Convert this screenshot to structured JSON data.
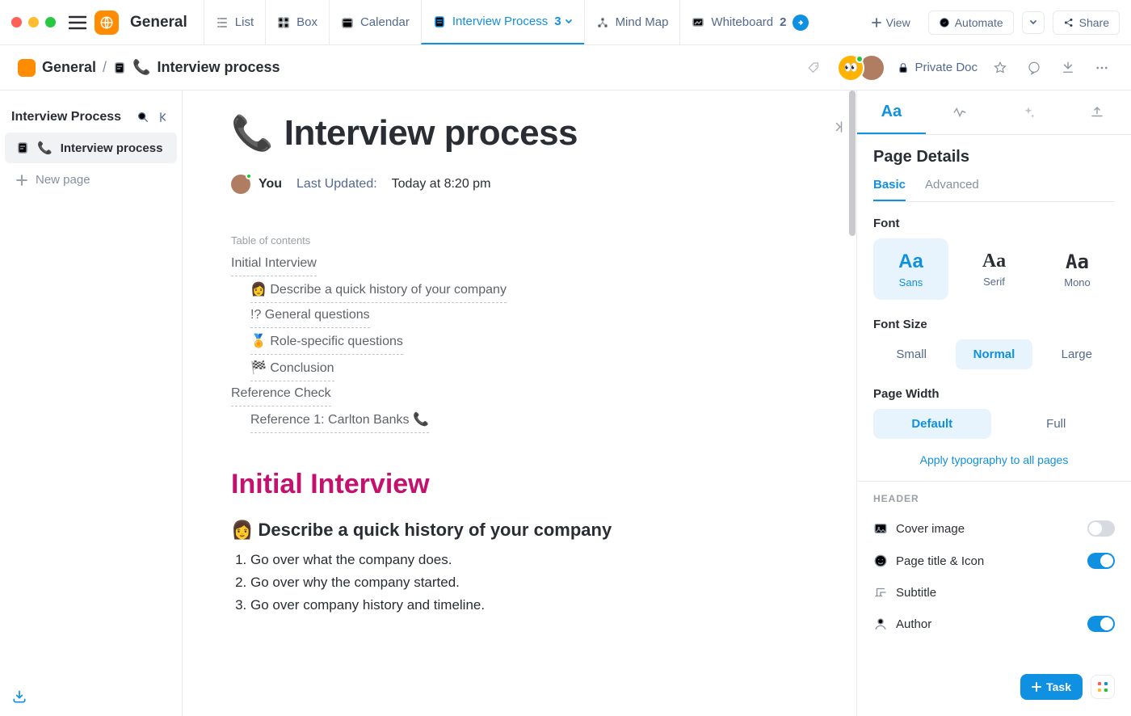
{
  "workspace": {
    "name": "General"
  },
  "top_tabs": {
    "list": "List",
    "box": "Box",
    "calendar": "Calendar",
    "interview": {
      "label": "Interview Process",
      "count": "3"
    },
    "mindmap": "Mind Map",
    "whiteboard": {
      "label": "Whiteboard",
      "count": "2"
    },
    "view": "View",
    "automate": "Automate",
    "share": "Share"
  },
  "breadcrumb": {
    "root": "General",
    "page": "Interview process",
    "private": "Private Doc"
  },
  "left": {
    "title": "Interview Process",
    "item": "Interview process",
    "new_page": "New page"
  },
  "doc": {
    "title": "Interview process",
    "you": "You",
    "updated_label": "Last Updated:",
    "updated_value": "Today at 8:20 pm",
    "toc_label": "Table of contents",
    "toc": {
      "a": "Initial Interview",
      "b": "👩 Describe a quick history of your company",
      "c": "!? General questions",
      "d": "🏅 Role-specific questions",
      "e": "🏁 Conclusion",
      "f": "Reference Check",
      "g": "Reference 1: Carlton Banks 📞"
    },
    "h1": "Initial Interview",
    "h2": "👩 Describe a quick history of your company",
    "ol": {
      "a": "Go over what the company does.",
      "b": "Go over why the company started.",
      "c": "Go over company history and timeline."
    }
  },
  "panel": {
    "title": "Page Details",
    "tab_basic": "Basic",
    "tab_advanced": "Advanced",
    "font_label": "Font",
    "font": {
      "sans": "Sans",
      "serif": "Serif",
      "mono": "Mono",
      "aa": "Aa"
    },
    "fontsize_label": "Font Size",
    "size": {
      "small": "Small",
      "normal": "Normal",
      "large": "Large"
    },
    "width_label": "Page Width",
    "width": {
      "default": "Default",
      "full": "Full"
    },
    "apply": "Apply typography to all pages",
    "header_label": "HEADER",
    "rows": {
      "cover": "Cover image",
      "pticon": "Page title & Icon",
      "subtitle": "Subtitle",
      "author": "Author"
    }
  },
  "fab": {
    "task": "Task"
  }
}
